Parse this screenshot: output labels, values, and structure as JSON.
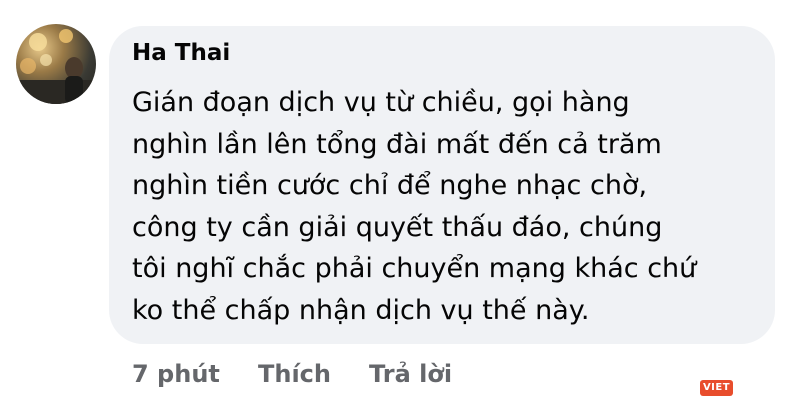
{
  "comment": {
    "author": "Ha Thai",
    "lines": [
      "Gián đoạn dịch vụ từ chiều, gọi hàng",
      "nghìn lần lên tổng đài mất đến cả trăm",
      "nghìn tiền cước chỉ để nghe nhạc chờ,",
      "công ty cần giải quyết thấu đáo, chúng",
      "tôi nghĩ chắc phải chuyển mạng khác chứ",
      "ko thể chấp nhận dịch vụ thế này."
    ]
  },
  "actions": {
    "time": "7 phút",
    "like_label": "Thích",
    "reply_label": "Trả lời"
  },
  "watermark": {
    "text": "VIET",
    "color": "#e84d2c"
  },
  "colors": {
    "bubble": "#f0f2f5",
    "text": "#050505",
    "secondary_text": "#65676b"
  },
  "icons": {
    "avatar": "user-photo-avatar"
  }
}
